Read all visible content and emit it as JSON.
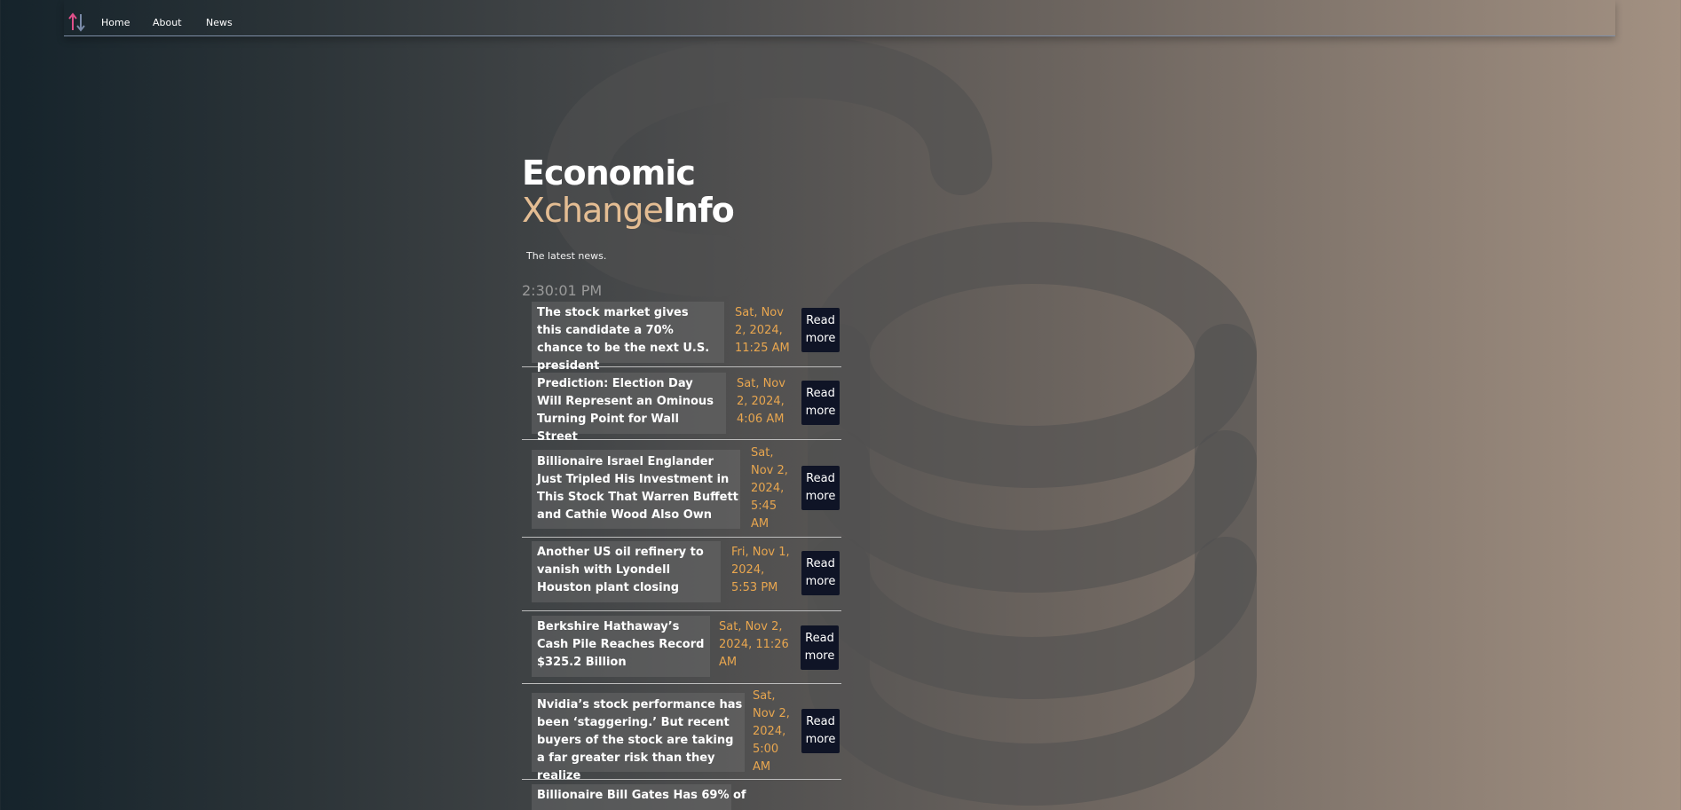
{
  "nav": {
    "logo": "up-down-arrows-icon",
    "links": [
      "Home",
      "About",
      "News"
    ]
  },
  "brand": {
    "line1": "Economic",
    "line2_accent": "Xchange",
    "line2_rest": "Info"
  },
  "tagline": "The latest news.",
  "clock": "2:30:01 PM",
  "read_more_label": "Read more",
  "news": [
    {
      "headline": "The stock market gives this candidate a 70% chance to be the next U.S. president",
      "date": "Sat, Nov 2, 2024, 11:25 AM"
    },
    {
      "headline": "Prediction: Election Day Will Represent an Ominous Turning Point for Wall Street",
      "date": "Sat, Nov 2, 2024, 4:06 AM"
    },
    {
      "headline": "Billionaire Israel Englander Just Tripled His Investment in This Stock That Warren Buffett and Cathie Wood Also Own",
      "date": "Sat, Nov 2, 2024, 5:45 AM"
    },
    {
      "headline": "Another US oil refinery to vanish with Lyondell Houston plant closing",
      "date": "Fri, Nov 1, 2024, 5:53 PM"
    },
    {
      "headline": "Berkshire Hathaway’s Cash Pile Reaches Record $325.2 Billion",
      "date": "Sat, Nov 2, 2024, 11:26 AM"
    },
    {
      "headline": "Nvidia’s stock performance has been ‘staggering.’ But recent buyers of the stock are taking a far greater risk than they realize",
      "date": "Sat, Nov 2, 2024, 5:00 AM"
    },
    {
      "headline": "Billionaire Bill Gates Has 69% of",
      "date": ""
    }
  ],
  "colors": {
    "accent": "#e4bd93",
    "date": "#e8a64f",
    "button": "#0f1426",
    "logo_pink": "#e0508a",
    "logo_slate": "#7a8aa8"
  }
}
